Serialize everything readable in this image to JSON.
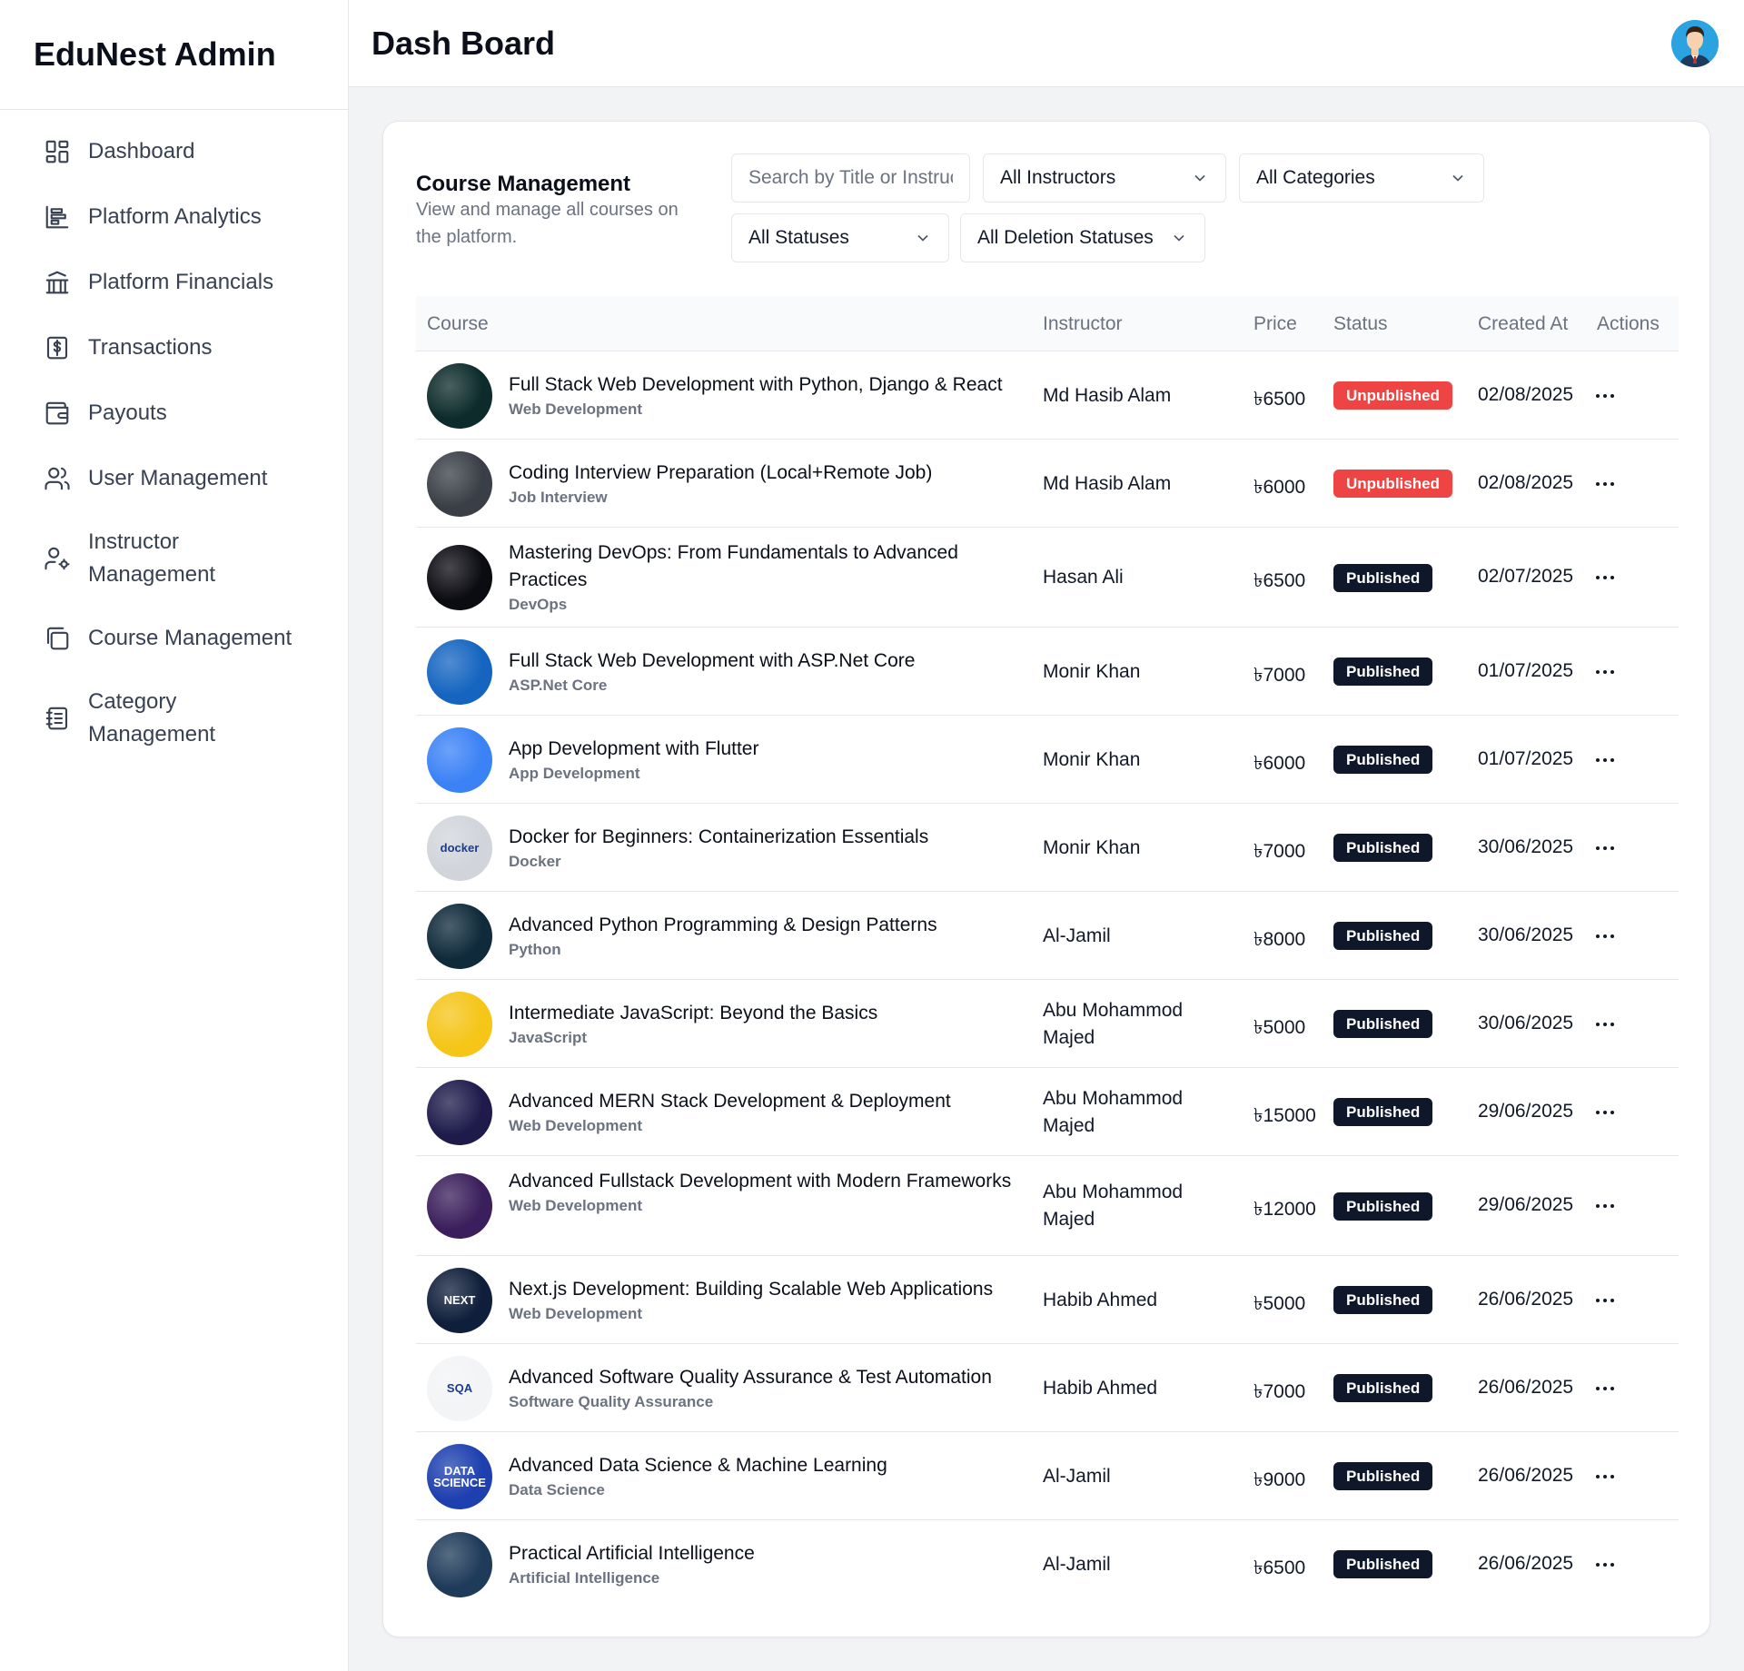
{
  "sidebar": {
    "brand": "EduNest Admin",
    "items": [
      {
        "label": "Dashboard",
        "icon": "dashboard-grid-icon"
      },
      {
        "label": "Platform Analytics",
        "icon": "analytics-icon"
      },
      {
        "label": "Platform Financials",
        "icon": "bank-icon"
      },
      {
        "label": "Transactions",
        "icon": "dollar-receipt-icon"
      },
      {
        "label": "Payouts",
        "icon": "wallet-icon"
      },
      {
        "label": "User Management",
        "icon": "users-icon"
      },
      {
        "label": "Instructor Management",
        "icon": "user-cog-icon"
      },
      {
        "label": "Course Management",
        "icon": "copy-icon"
      },
      {
        "label": "Category Management",
        "icon": "notebook-list-icon"
      }
    ]
  },
  "header": {
    "title": "Dash Board"
  },
  "course_management": {
    "title": "Course Management",
    "subtitle": "View and manage all courses on the platform.",
    "search_placeholder": "Search by Title or Instructor",
    "filters": {
      "instructors": "All Instructors",
      "categories": "All Categories",
      "statuses": "All Statuses",
      "deletion": "All Deletion Statuses"
    },
    "columns": [
      "Course",
      "Instructor",
      "Price",
      "Status",
      "Created At",
      "Actions"
    ],
    "rows": [
      {
        "title": "Full Stack Web Development with Python, Django & React",
        "category": "Web Development",
        "instructor": "Md Hasib Alam",
        "price": "৳6500",
        "status": "Unpublished",
        "created": "02/08/2025"
      },
      {
        "title": "Coding Interview Preparation (Local+Remote Job)",
        "category": "Job Interview",
        "instructor": "Md Hasib Alam",
        "price": "৳6000",
        "status": "Unpublished",
        "created": "02/08/2025"
      },
      {
        "title": "Mastering DevOps: From Fundamentals to Advanced Practices",
        "category": "DevOps",
        "instructor": "Hasan Ali",
        "price": "৳6500",
        "status": "Published",
        "created": "02/07/2025"
      },
      {
        "title": "Full Stack Web Development with ASP.Net Core",
        "category": "ASP.Net Core",
        "instructor": "Monir Khan",
        "price": "৳7000",
        "status": "Published",
        "created": "01/07/2025"
      },
      {
        "title": "App Development with Flutter",
        "category": "App Development",
        "instructor": "Monir Khan",
        "price": "৳6000",
        "status": "Published",
        "created": "01/07/2025"
      },
      {
        "title": "Docker for Beginners: Containerization Essentials",
        "category": "Docker",
        "instructor": "Monir Khan",
        "price": "৳7000",
        "status": "Published",
        "created": "30/06/2025"
      },
      {
        "title": "Advanced Python Programming & Design Patterns",
        "category": "Python",
        "instructor": "Al-Jamil",
        "price": "৳8000",
        "status": "Published",
        "created": "30/06/2025"
      },
      {
        "title": "Intermediate JavaScript: Beyond the Basics",
        "category": "JavaScript",
        "instructor": "Abu Mohammod Majed",
        "price": "৳5000",
        "status": "Published",
        "created": "30/06/2025"
      },
      {
        "title": "Advanced MERN Stack Development & Deployment",
        "category": "Web Development",
        "instructor": "Abu Mohammod Majed",
        "price": "৳15000",
        "status": "Published",
        "created": "29/06/2025"
      },
      {
        "title": "Advanced Fullstack Development with Modern Frameworks",
        "category": "Web Development",
        "instructor": "Abu Mohammod Majed",
        "price": "৳12000",
        "status": "Published",
        "created": "29/06/2025"
      },
      {
        "title": "Next.js Development: Building Scalable Web Applications",
        "category": "Web Development",
        "instructor": "Habib Ahmed",
        "price": "৳5000",
        "status": "Published",
        "created": "26/06/2025"
      },
      {
        "title": "Advanced Software Quality Assurance & Test Automation",
        "category": "Software Quality Assurance",
        "instructor": "Habib Ahmed",
        "price": "৳7000",
        "status": "Published",
        "created": "26/06/2025"
      },
      {
        "title": "Advanced Data Science & Machine Learning",
        "category": "Data Science",
        "instructor": "Al-Jamil",
        "price": "৳9000",
        "status": "Published",
        "created": "26/06/2025"
      },
      {
        "title": "Practical Artificial Intelligence",
        "category": "Artificial Intelligence",
        "instructor": "Al-Jamil",
        "price": "৳6500",
        "status": "Published",
        "created": "26/06/2025"
      }
    ],
    "thumbnail_logos": [
      "docker",
      "SQA",
      "NEXT",
      "DATA SCIENCE"
    ]
  },
  "colors": {
    "unpublished": "#ef4444",
    "published": "#0f172a",
    "thumbnails": [
      "#0d2b2b",
      "#3a3f47",
      "#0b0b12",
      "#1565c0",
      "#3b82f6",
      "#d1d5db",
      "#0f2a3a",
      "#f5c518",
      "#1e1b4b",
      "#3b1f5c",
      "#0f1e3a",
      "#f3f4f6",
      "#1e40af",
      "#1f3b5a"
    ]
  }
}
